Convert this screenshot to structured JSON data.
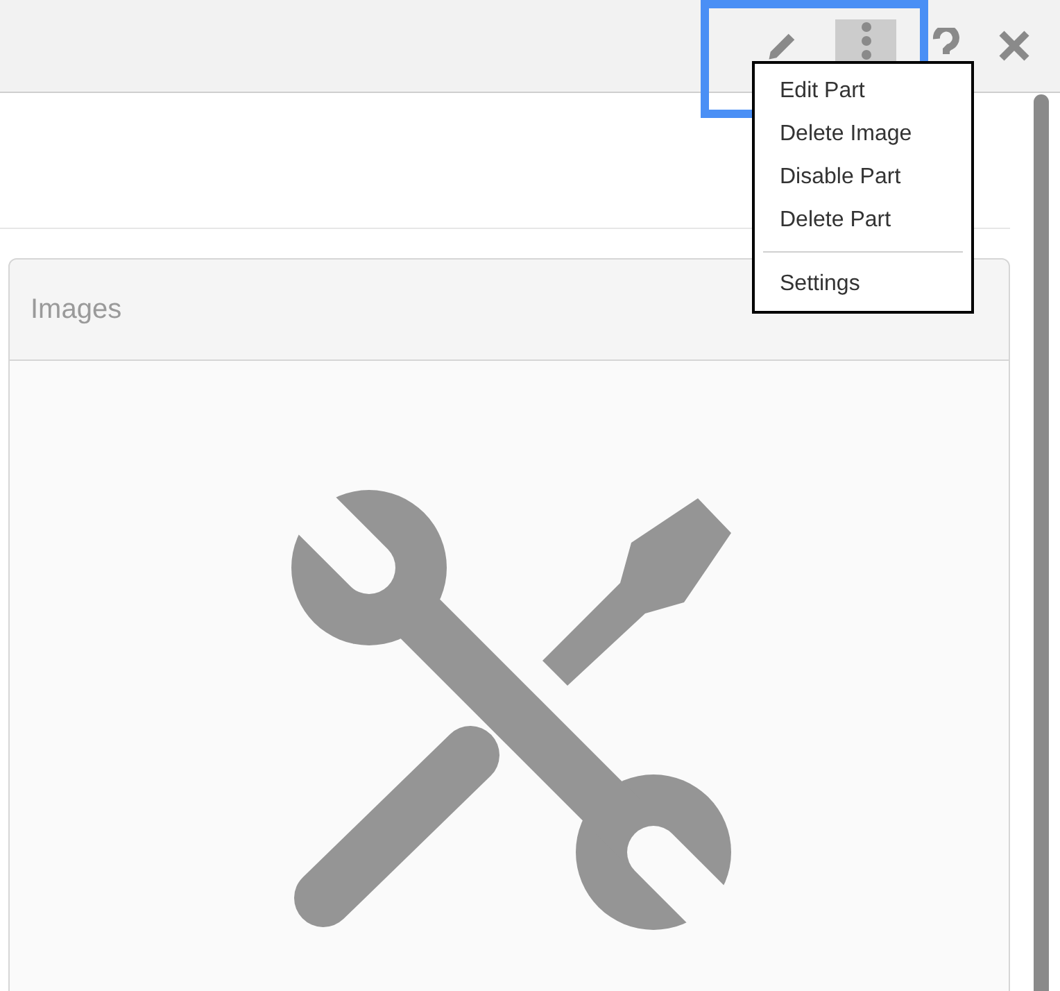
{
  "menu": {
    "items": [
      {
        "label": "Edit Part",
        "separator_before": false
      },
      {
        "label": "Delete Image",
        "separator_before": false
      },
      {
        "label": "Disable Part",
        "separator_before": false
      },
      {
        "label": "Delete Part",
        "separator_before": false
      },
      {
        "label": "Settings",
        "separator_before": true
      }
    ]
  },
  "panel": {
    "title": "Images"
  }
}
